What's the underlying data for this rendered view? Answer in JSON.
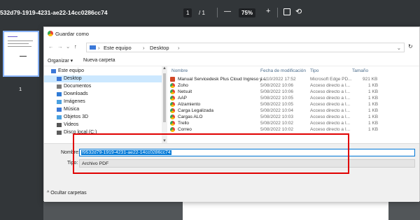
{
  "viewer": {
    "title": "532d79-1919-4231-ae22-14cc0286cc74",
    "page_current": "1",
    "page_total": "/ 1",
    "zoom": "75%",
    "zoom_out_label": "—",
    "zoom_in_label": "+",
    "thumbnail_page_number": "1"
  },
  "dialog": {
    "title": "Guardar como",
    "address": {
      "sep1": "›",
      "root": "Este equipo",
      "sep2": "›",
      "current": "Desktop",
      "sep3": "›"
    },
    "toolbar": {
      "organize": "Organizar ▾",
      "new_folder": "Nueva carpeta"
    },
    "nav_items": [
      {
        "label": "Este equipo",
        "color": "#3b78d8"
      },
      {
        "label": "Desktop",
        "color": "#3b78d8"
      },
      {
        "label": "Documentos",
        "color": "#7a7a7a"
      },
      {
        "label": "Downloads",
        "color": "#2f7bd6"
      },
      {
        "label": "Imágenes",
        "color": "#4aa0e0"
      },
      {
        "label": "Música",
        "color": "#3b78d8"
      },
      {
        "label": "Objetos 3D",
        "color": "#4aa0e0"
      },
      {
        "label": "Videos",
        "color": "#555555"
      },
      {
        "label": "Disco local (C:)",
        "color": "#5d5d5d"
      }
    ],
    "columns": {
      "name": "Nombre",
      "date": "Fecha de modificación",
      "type": "Tipo",
      "size": "Tamaño"
    },
    "files": [
      {
        "name": "Manual Servicedesk Plus Cloud Ingreso y ...",
        "date": "14/10/2022 17:52",
        "type": "Microsoft Edge PD...",
        "size": "921 KB",
        "icon": "pdf"
      },
      {
        "name": "Zoho",
        "date": "5/08/2022 10:06",
        "type": "Acceso directo a I...",
        "size": "1 KB",
        "icon": "edge"
      },
      {
        "name": "Netsuit",
        "date": "5/08/2022 10:06",
        "type": "Acceso directo a I...",
        "size": "1 KB",
        "icon": "edge"
      },
      {
        "name": "AAP",
        "date": "5/08/2022 10:05",
        "type": "Acceso directo a I...",
        "size": "1 KB",
        "icon": "edge"
      },
      {
        "name": "Alzamiento",
        "date": "5/08/2022 10:05",
        "type": "Acceso directo a I...",
        "size": "1 KB",
        "icon": "edge"
      },
      {
        "name": "Carga Legalizada",
        "date": "5/08/2022 10:04",
        "type": "Acceso directo a I...",
        "size": "1 KB",
        "icon": "edge"
      },
      {
        "name": "Cargas ALO",
        "date": "5/08/2022 10:03",
        "type": "Acceso directo a I...",
        "size": "1 KB",
        "icon": "edge"
      },
      {
        "name": "Trello",
        "date": "5/08/2022 10:02",
        "type": "Acceso directo a I...",
        "size": "1 KB",
        "icon": "edge"
      },
      {
        "name": "Correo",
        "date": "5/08/2022 10:02",
        "type": "Acceso directo a I...",
        "size": "1 KB",
        "icon": "edge"
      }
    ],
    "filename_label": "Nombre:",
    "filename_value": "f9532d79-1919-4231-ae22-14cc0286cc74",
    "filetype_label": "Tipo:",
    "filetype_value": "Archivo PDF",
    "hide_folders": "^ Ocultar carpetas"
  },
  "colors": {
    "highlight": "#e00000",
    "selection": "#0078d7"
  }
}
